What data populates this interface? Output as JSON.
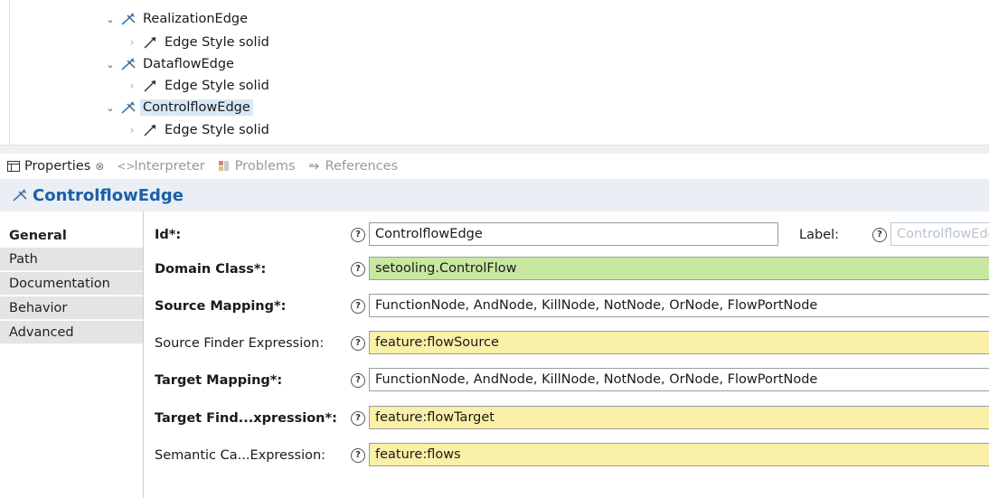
{
  "tree": {
    "items": [
      {
        "label": "RealizationEdge",
        "kind": "edge",
        "expanded": true,
        "selected": false
      },
      {
        "label": "Edge Style solid",
        "kind": "style",
        "expanded": false,
        "selected": false
      },
      {
        "label": "DataflowEdge",
        "kind": "edge",
        "expanded": true,
        "selected": false
      },
      {
        "label": "Edge Style solid",
        "kind": "style",
        "expanded": false,
        "selected": false
      },
      {
        "label": "ControlflowEdge",
        "kind": "edge",
        "expanded": true,
        "selected": true
      },
      {
        "label": "Edge Style solid",
        "kind": "style",
        "expanded": false,
        "selected": false
      }
    ]
  },
  "tabs": [
    {
      "label": "Properties",
      "active": true,
      "close": "⊗"
    },
    {
      "label": "Interpreter",
      "active": false
    },
    {
      "label": "Problems",
      "active": false
    },
    {
      "label": "References",
      "active": false
    }
  ],
  "header": {
    "title": "ControlflowEdge"
  },
  "nav": [
    {
      "label": "General",
      "active": true
    },
    {
      "label": "Path",
      "active": false
    },
    {
      "label": "Documentation",
      "active": false
    },
    {
      "label": "Behavior",
      "active": false
    },
    {
      "label": "Advanced",
      "active": false
    }
  ],
  "form": {
    "id": {
      "label": "Id*:",
      "value": "ControlflowEdge"
    },
    "label_field": {
      "label": "Label:",
      "value": "ControlflowEdge"
    },
    "domain_class": {
      "label": "Domain Class*:",
      "value": "setooling.ControlFlow"
    },
    "source_mapping": {
      "label": "Source Mapping*:",
      "value": "FunctionNode, AndNode, KillNode, NotNode, OrNode, FlowPortNode"
    },
    "source_finder": {
      "label": "Source Finder Expression:",
      "value": "feature:flowSource"
    },
    "target_mapping": {
      "label": "Target Mapping*:",
      "value": "FunctionNode, AndNode, KillNode, NotNode, OrNode, FlowPortNode"
    },
    "target_finder": {
      "label": "Target Find...xpression*:",
      "value": "feature:flowTarget"
    },
    "semantic_candidates": {
      "label": "Semantic Ca...Expression:",
      "value": "feature:flows"
    },
    "help_glyph": "?"
  },
  "colors": {
    "green_field": "#c8e8a2",
    "yellow_field": "#fbf0a7",
    "header_title": "#1c5fa8",
    "selection": "#d9e8f8"
  }
}
